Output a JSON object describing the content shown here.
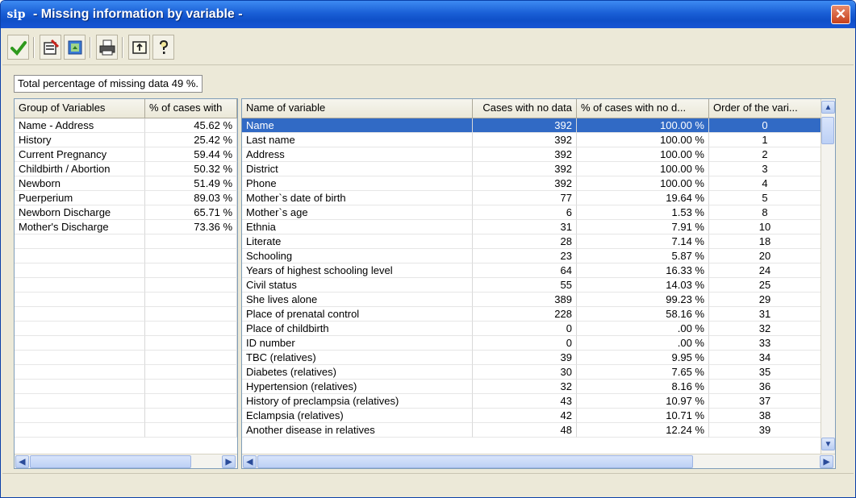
{
  "window": {
    "title": "- Missing information by variable -",
    "icon_text": "sip",
    "close_label": "✕"
  },
  "toolbar": {
    "buttons": [
      "accept-icon",
      "missing-cases-icon",
      "export-grid-icon",
      "print-icon",
      "exit-icon",
      "help-icon"
    ]
  },
  "summary": {
    "text": "Total percentage of missing data  49 %."
  },
  "groups": {
    "headers": [
      "Group of Variables",
      "% of cases with"
    ],
    "rows": [
      [
        "Name - Address",
        "45.62 %"
      ],
      [
        "History",
        "25.42 %"
      ],
      [
        "Current Pregnancy",
        "59.44 %"
      ],
      [
        "Childbirth / Abortion",
        "50.32 %"
      ],
      [
        "Newborn",
        "51.49 %"
      ],
      [
        "Puerperium",
        "89.03 %"
      ],
      [
        "Newborn Discharge",
        "65.71 %"
      ],
      [
        "Mother's Discharge",
        "73.36 %"
      ]
    ]
  },
  "variables": {
    "headers": [
      "Name of variable",
      "Cases with no data",
      "% of cases with no d...",
      "Order of the vari..."
    ],
    "rows": [
      [
        "Name",
        "392",
        "100.00 %",
        "0"
      ],
      [
        "Last name",
        "392",
        "100.00 %",
        "1"
      ],
      [
        "Address",
        "392",
        "100.00 %",
        "2"
      ],
      [
        "District",
        "392",
        "100.00 %",
        "3"
      ],
      [
        "Phone",
        "392",
        "100.00 %",
        "4"
      ],
      [
        "Mother`s date of birth",
        "77",
        "19.64 %",
        "5"
      ],
      [
        "Mother`s age",
        "6",
        "1.53 %",
        "8"
      ],
      [
        "Ethnia",
        "31",
        "7.91 %",
        "10"
      ],
      [
        "Literate",
        "28",
        "7.14 %",
        "18"
      ],
      [
        "Schooling",
        "23",
        "5.87 %",
        "20"
      ],
      [
        "Years of highest schooling level",
        "64",
        "16.33 %",
        "24"
      ],
      [
        "Civil status",
        "55",
        "14.03 %",
        "25"
      ],
      [
        "She lives alone",
        "389",
        "99.23 %",
        "29"
      ],
      [
        "Place of prenatal control",
        "228",
        "58.16 %",
        "31"
      ],
      [
        "Place of childbirth",
        "0",
        ".00 %",
        "32"
      ],
      [
        "ID number",
        "0",
        ".00 %",
        "33"
      ],
      [
        "TBC (relatives)",
        "39",
        "9.95 %",
        "34"
      ],
      [
        "Diabetes (relatives)",
        "30",
        "7.65 %",
        "35"
      ],
      [
        "Hypertension (relatives)",
        "32",
        "8.16 %",
        "36"
      ],
      [
        "History of preclampsia (relatives)",
        "43",
        "10.97 %",
        "37"
      ],
      [
        "Eclampsia  (relatives)",
        "42",
        "10.71 %",
        "38"
      ],
      [
        "Another disease in relatives",
        "48",
        "12.24 %",
        "39"
      ]
    ],
    "selected_row": 0
  }
}
